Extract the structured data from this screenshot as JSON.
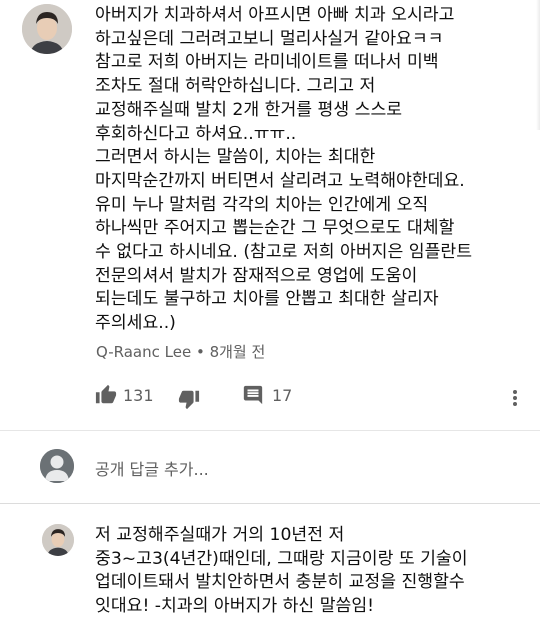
{
  "comment1": {
    "lines": [
      "아버지가 치과하셔서 아프시면 아빠 치과 오시라고",
      "하고싶은데 그러려고보니 멀리사실거 같아요ㅋㅋ",
      "참고로 저희 아버지는 라미네이트를 떠나서 미백",
      "조차도 절대 허락안하십니다. 그리고 저",
      "교정해주실때 발치 2개 한거를 평생 스스로",
      "후회하신다고 하셔요..ㅠㅠ..",
      "그러면서 하시는 말씀이, 치아는 최대한",
      "마지막순간까지 버티면서 살리려고 노력해야한데요.",
      "유미 누나 말처럼 각각의 치아는 인간에게 오직",
      "하나씩만 주어지고 뽑는순간 그 무엇으로도 대체할",
      "수 없다고 하시네요. (참고로 저희 아버지은 임플란트",
      "전문의셔서 발치가 잠재적으로 영업에 도움이",
      "되는데도 불구하고 치아를 안뽑고 최대한 살리자",
      "주의세요..)"
    ],
    "author": "Q-Raanc Lee",
    "time": "8개월 전",
    "likes": "131",
    "replies": "17"
  },
  "reply_box": {
    "placeholder": "공개 답글 추가..."
  },
  "comment2": {
    "lines": [
      "저 교정해주실때가 거의 10년전 저",
      "중3~고3(4년간)때인데, 그때랑 지금이랑 또 기술이",
      "업데이트돼서 발치안하면서 충분히 교정을 진행할수",
      "잇대요! -치과의 아버지가 하신 말씀임!"
    ]
  },
  "icons": {
    "like": "thumbs-up-icon",
    "dislike": "thumbs-down-icon",
    "reply": "comment-icon",
    "more": "more-vert-icon",
    "account": "account-icon"
  },
  "colors": {
    "text": "#0f0f0f",
    "secondary": "#606060",
    "divider": "#e6e6e6"
  }
}
